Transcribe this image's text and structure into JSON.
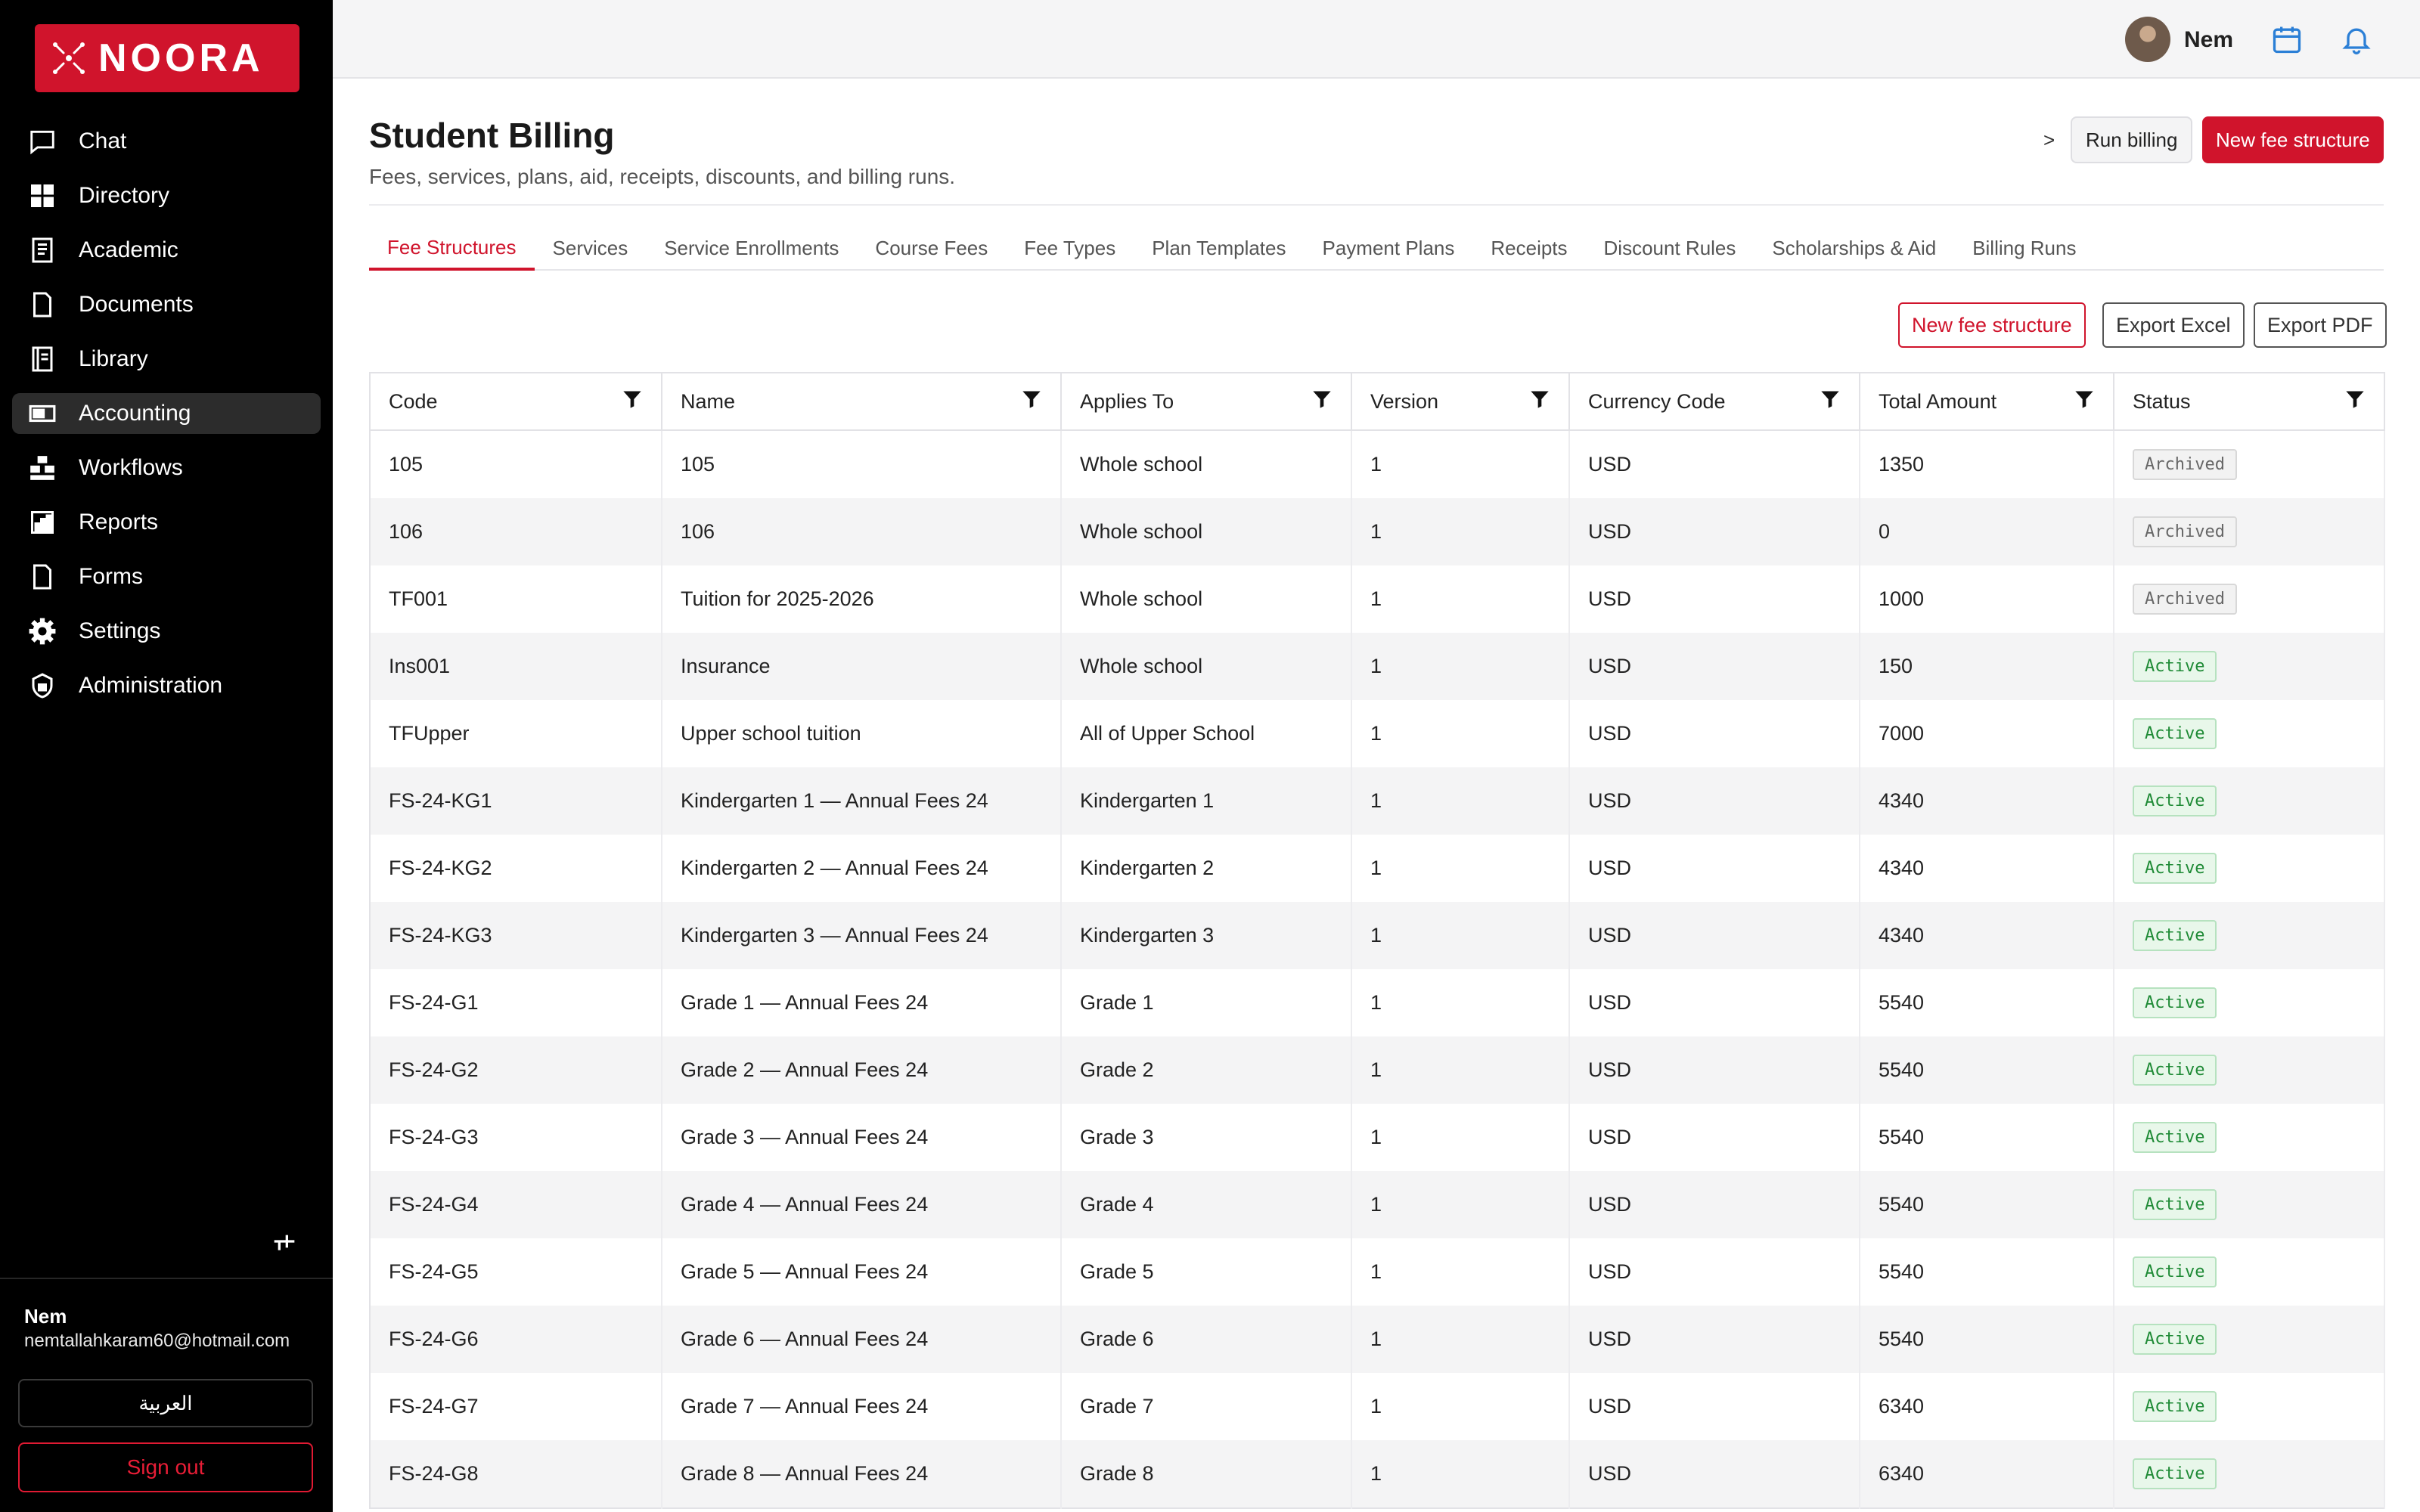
{
  "app": {
    "name": "NOORA"
  },
  "sidebar": {
    "items": [
      {
        "label": "Chat",
        "icon": "chat-icon"
      },
      {
        "label": "Directory",
        "icon": "directory-icon"
      },
      {
        "label": "Academic",
        "icon": "academic-icon"
      },
      {
        "label": "Documents",
        "icon": "documents-icon"
      },
      {
        "label": "Library",
        "icon": "library-icon"
      },
      {
        "label": "Accounting",
        "icon": "accounting-icon",
        "active": true
      },
      {
        "label": "Workflows",
        "icon": "workflows-icon"
      },
      {
        "label": "Reports",
        "icon": "reports-icon"
      },
      {
        "label": "Forms",
        "icon": "forms-icon"
      },
      {
        "label": "Settings",
        "icon": "settings-icon"
      },
      {
        "label": "Administration",
        "icon": "administration-icon"
      }
    ],
    "user": {
      "name": "Nem",
      "email": "nemtallahkaram60@hotmail.com"
    },
    "language_button": "العربية",
    "signout_button": "Sign out"
  },
  "topbar": {
    "username": "Nem"
  },
  "header": {
    "title": "Student Billing",
    "subtitle": "Fees, services, plans, aid, receipts, discounts, and billing runs.",
    "breadcrumb_chevron": ">",
    "run_billing": "Run billing",
    "new_fee_structure": "New fee structure"
  },
  "tabs": [
    "Fee Structures",
    "Services",
    "Service Enrollments",
    "Course Fees",
    "Fee Types",
    "Plan Templates",
    "Payment Plans",
    "Receipts",
    "Discount Rules",
    "Scholarships & Aid",
    "Billing Runs"
  ],
  "actions": {
    "new": "New fee structure",
    "export_excel": "Export Excel",
    "export_pdf": "Export PDF"
  },
  "table": {
    "columns": [
      "Code",
      "Name",
      "Applies To",
      "Version",
      "Currency Code",
      "Total Amount",
      "Status"
    ],
    "rows": [
      [
        "105",
        "105",
        "Whole school",
        "1",
        "USD",
        "1350",
        "Archived"
      ],
      [
        "106",
        "106",
        "Whole school",
        "1",
        "USD",
        "0",
        "Archived"
      ],
      [
        "TF001",
        "Tuition for 2025-2026",
        "Whole school",
        "1",
        "USD",
        "1000",
        "Archived"
      ],
      [
        "Ins001",
        "Insurance",
        "Whole school",
        "1",
        "USD",
        "150",
        "Active"
      ],
      [
        "TFUpper",
        "Upper school tuition",
        "All of Upper School",
        "1",
        "USD",
        "7000",
        "Active"
      ],
      [
        "FS-24-KG1",
        "Kindergarten 1 — Annual Fees 24",
        "Kindergarten 1",
        "1",
        "USD",
        "4340",
        "Active"
      ],
      [
        "FS-24-KG2",
        "Kindergarten 2 — Annual Fees 24",
        "Kindergarten 2",
        "1",
        "USD",
        "4340",
        "Active"
      ],
      [
        "FS-24-KG3",
        "Kindergarten 3 — Annual Fees 24",
        "Kindergarten 3",
        "1",
        "USD",
        "4340",
        "Active"
      ],
      [
        "FS-24-G1",
        "Grade 1 — Annual Fees 24",
        "Grade 1",
        "1",
        "USD",
        "5540",
        "Active"
      ],
      [
        "FS-24-G2",
        "Grade 2 — Annual Fees 24",
        "Grade 2",
        "1",
        "USD",
        "5540",
        "Active"
      ],
      [
        "FS-24-G3",
        "Grade 3 — Annual Fees 24",
        "Grade 3",
        "1",
        "USD",
        "5540",
        "Active"
      ],
      [
        "FS-24-G4",
        "Grade 4 — Annual Fees 24",
        "Grade 4",
        "1",
        "USD",
        "5540",
        "Active"
      ],
      [
        "FS-24-G5",
        "Grade 5 — Annual Fees 24",
        "Grade 5",
        "1",
        "USD",
        "5540",
        "Active"
      ],
      [
        "FS-24-G6",
        "Grade 6 — Annual Fees 24",
        "Grade 6",
        "1",
        "USD",
        "5540",
        "Active"
      ],
      [
        "FS-24-G7",
        "Grade 7 — Annual Fees 24",
        "Grade 7",
        "1",
        "USD",
        "6340",
        "Active"
      ],
      [
        "FS-24-G8",
        "Grade 8 — Annual Fees 24",
        "Grade 8",
        "1",
        "USD",
        "6340",
        "Active"
      ]
    ]
  },
  "colors": {
    "brand": "#d0142c",
    "sidebar_bg": "#000000",
    "active_badge": "#1e8a35",
    "archived_badge": "#666666"
  }
}
